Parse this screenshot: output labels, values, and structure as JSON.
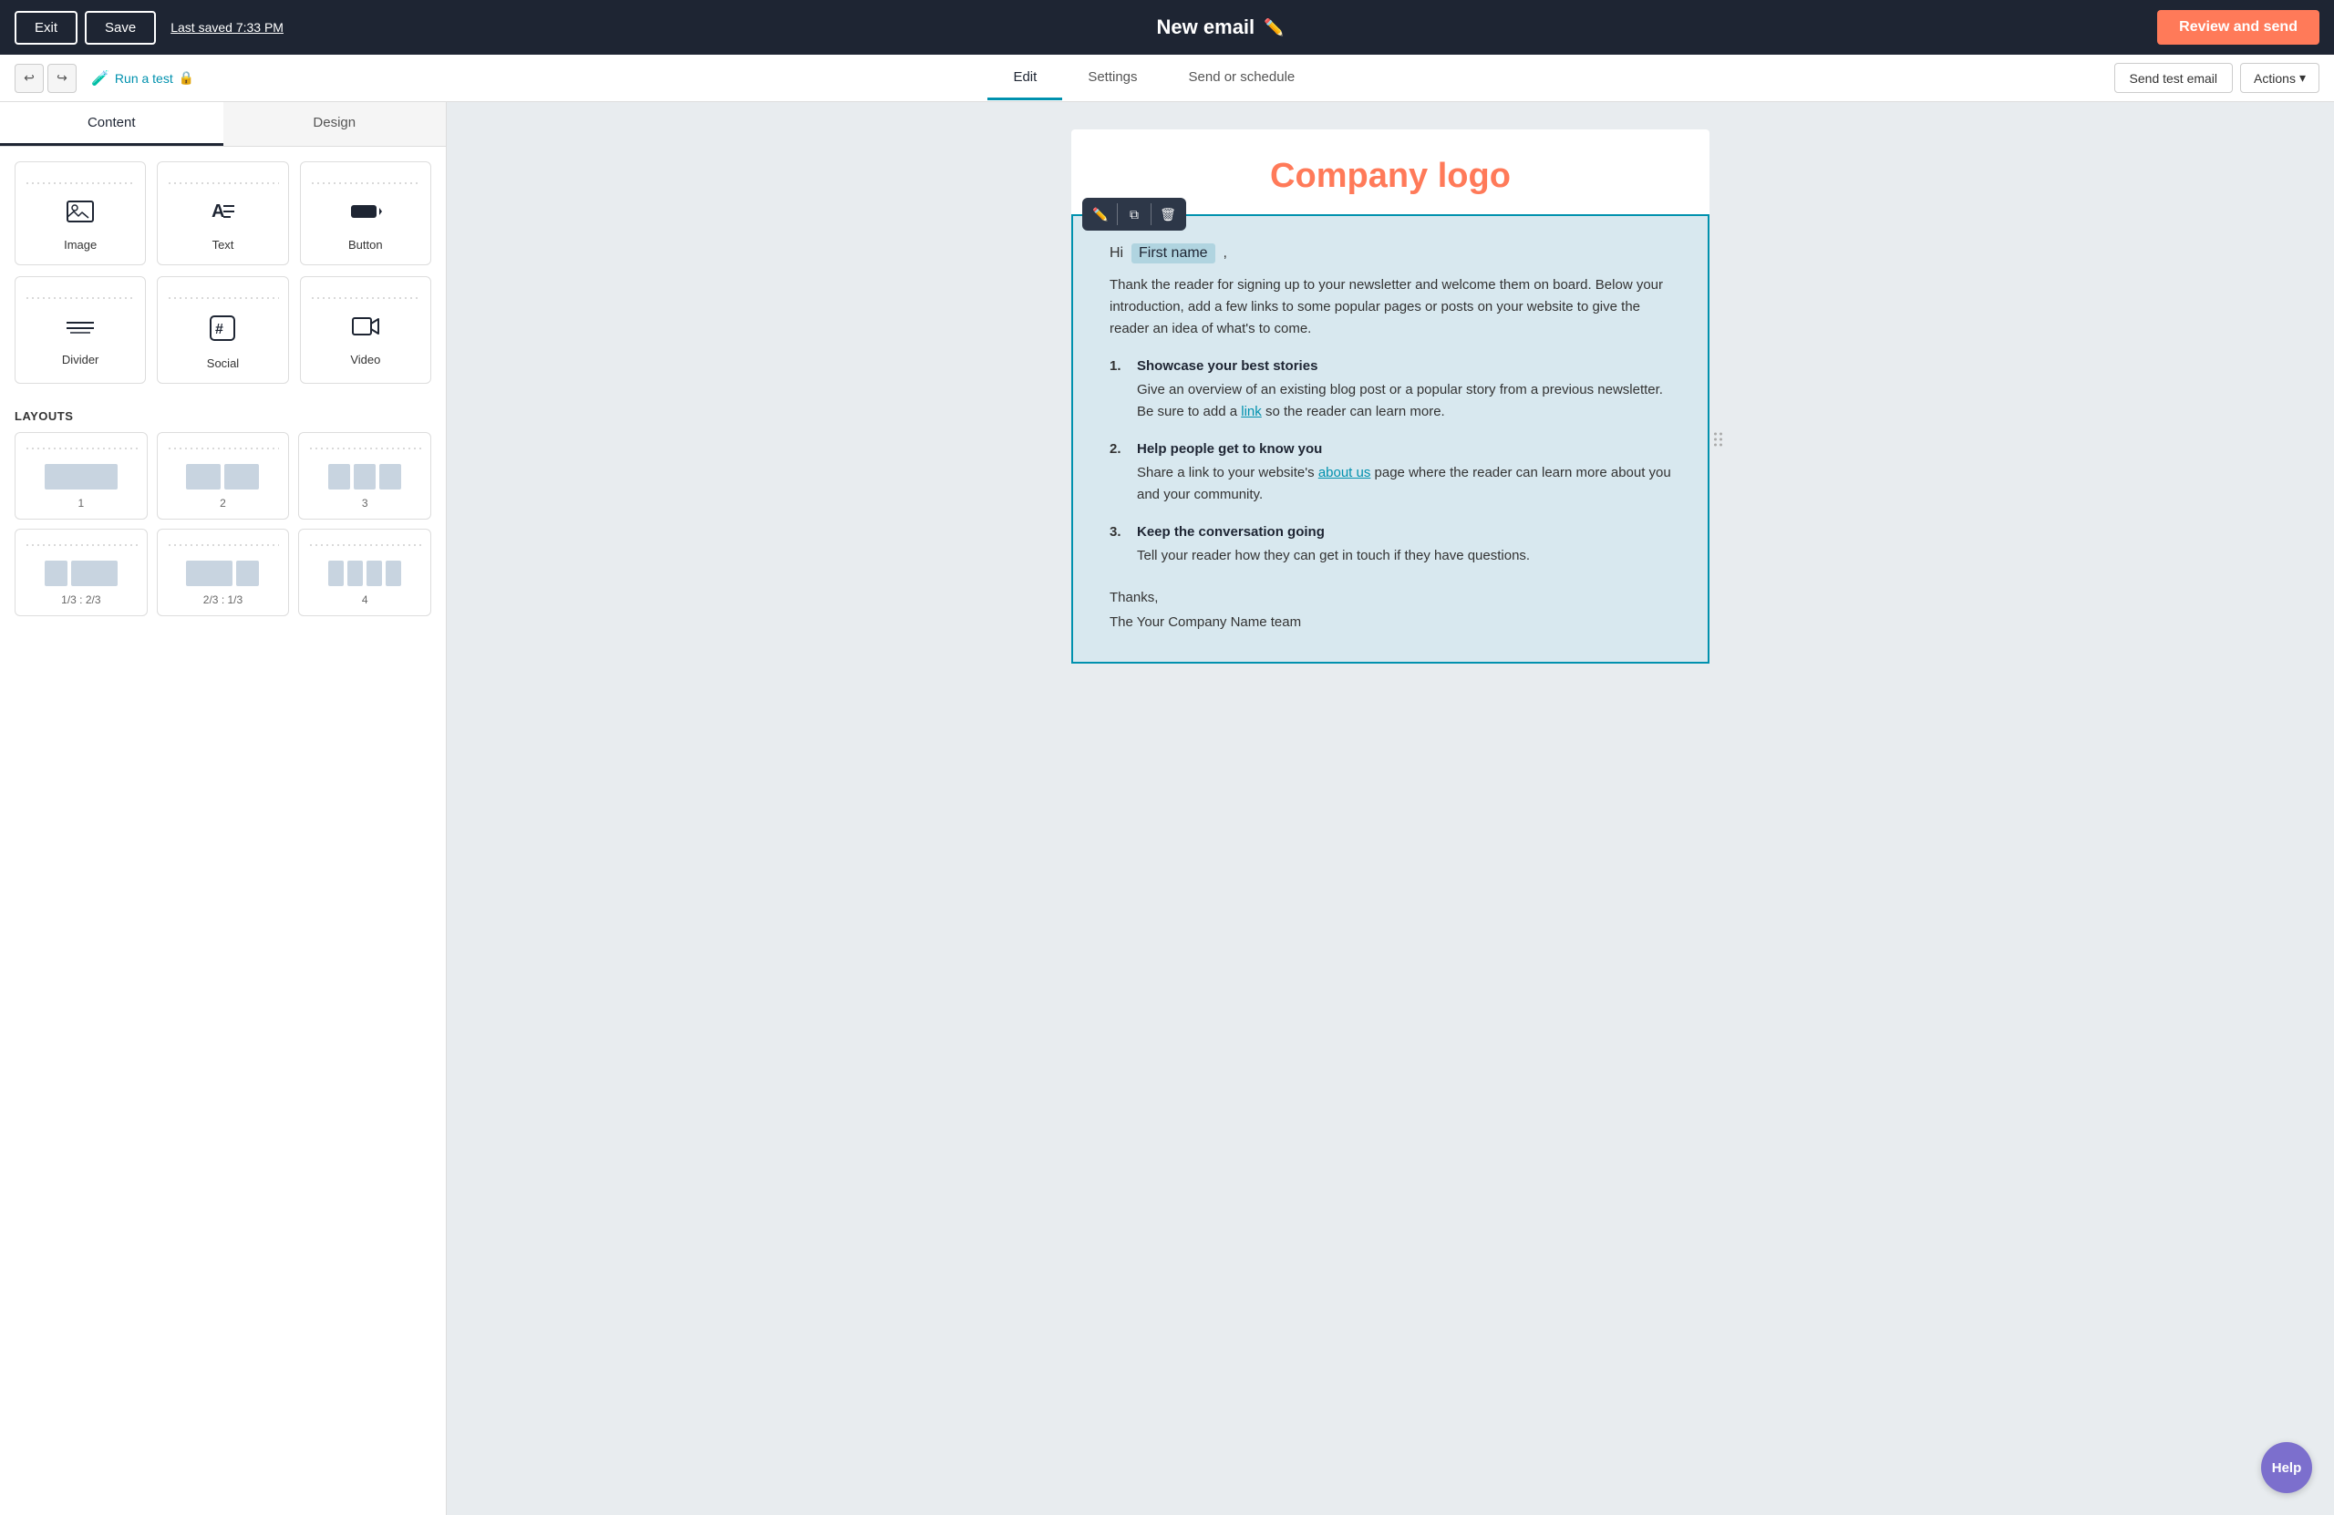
{
  "topNav": {
    "exitLabel": "Exit",
    "saveLabel": "Save",
    "lastSaved": "Last saved 7:33 PM",
    "emailTitle": "New email",
    "reviewSendLabel": "Review and send"
  },
  "secondaryNav": {
    "runTestLabel": "Run a test",
    "tabs": [
      {
        "id": "edit",
        "label": "Edit",
        "active": true
      },
      {
        "id": "settings",
        "label": "Settings",
        "active": false
      },
      {
        "id": "sendSchedule",
        "label": "Send or schedule",
        "active": false
      }
    ],
    "sendTestEmailLabel": "Send test email",
    "actionsLabel": "Actions"
  },
  "leftPanel": {
    "tabs": [
      {
        "id": "content",
        "label": "Content",
        "active": true
      },
      {
        "id": "design",
        "label": "Design",
        "active": false
      }
    ],
    "blocks": [
      {
        "id": "image",
        "label": "Image",
        "icon": "🖼"
      },
      {
        "id": "text",
        "label": "Text",
        "icon": "📝"
      },
      {
        "id": "button",
        "label": "Button",
        "icon": "🔲"
      },
      {
        "id": "divider",
        "label": "Divider",
        "icon": "➖"
      },
      {
        "id": "social",
        "label": "Social",
        "icon": "#"
      },
      {
        "id": "video",
        "label": "Video",
        "icon": "▶"
      }
    ],
    "layoutsTitle": "LAYOUTS",
    "layouts": [
      {
        "id": "layout-1",
        "label": "1",
        "cols": [
          1
        ]
      },
      {
        "id": "layout-2",
        "label": "2",
        "cols": [
          0.5,
          0.5
        ]
      },
      {
        "id": "layout-3",
        "label": "3",
        "cols": [
          0.33,
          0.33,
          0.33
        ]
      },
      {
        "id": "layout-1-3-2-3",
        "label": "1/3 : 2/3",
        "cols": [
          0.33,
          0.67
        ]
      },
      {
        "id": "layout-2-3-1-3",
        "label": "2/3 : 1/3",
        "cols": [
          0.67,
          0.33
        ]
      },
      {
        "id": "layout-4",
        "label": "4",
        "cols": [
          0.25,
          0.25,
          0.25,
          0.25
        ]
      }
    ]
  },
  "emailCanvas": {
    "logoText": "Company logo",
    "bodyBlock": {
      "greeting": "Hi",
      "firstName": "First name",
      "introText": "Thank the reader for signing up to your newsletter and welcome them on board. Below your introduction, add a few links to some popular pages or posts on your website to give the reader an idea of what's to come.",
      "listItems": [
        {
          "title": "Showcase your best stories",
          "body": "Give an overview of an existing blog post or a popular story from a previous newsletter. Be sure to add a",
          "linkText": "link",
          "bodySuffix": "so the reader can learn more."
        },
        {
          "title": "Help people get to know you",
          "bodyBefore": "Share a link to your website's",
          "linkText": "about us",
          "bodyAfter": "page where the reader can learn more about you and your community."
        },
        {
          "title": "Keep the conversation going",
          "body": "Tell your reader how they can get in touch if they have questions."
        }
      ],
      "footer": "Thanks,\nThe Your Company Name team"
    }
  },
  "helpLabel": "Help"
}
